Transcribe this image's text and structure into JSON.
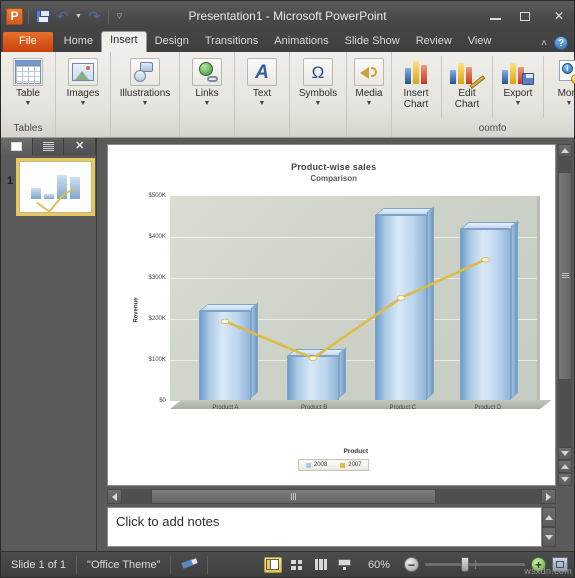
{
  "window": {
    "title": "Presentation1  -  Microsoft PowerPoint",
    "minimize_label": "–",
    "maximize_label": "□",
    "close_label": "✕"
  },
  "quick_access": {
    "app_logo": "P",
    "items": [
      {
        "name": "save-icon",
        "label": "Save"
      },
      {
        "name": "undo-icon",
        "label": "Undo"
      },
      {
        "name": "redo-icon",
        "label": "Redo"
      },
      {
        "name": "customize-icon",
        "label": "Customize Quick Access Toolbar"
      }
    ]
  },
  "tabs": [
    {
      "label": "File",
      "active": false
    },
    {
      "label": "Home",
      "active": false
    },
    {
      "label": "Insert",
      "active": true
    },
    {
      "label": "Design",
      "active": false
    },
    {
      "label": "Transitions",
      "active": false
    },
    {
      "label": "Animations",
      "active": false
    },
    {
      "label": "Slide Show",
      "active": false
    },
    {
      "label": "Review",
      "active": false
    },
    {
      "label": "View",
      "active": false
    }
  ],
  "tab_right": {
    "collapse_ribbon": "˄",
    "help": "?"
  },
  "ribbon": {
    "groups": [
      {
        "label": "Tables",
        "buttons": [
          {
            "label": "Table",
            "icon": "table-icon",
            "has_dropdown": true
          }
        ]
      },
      {
        "label": "",
        "buttons": [
          {
            "label": "Images",
            "icon": "images-icon",
            "has_dropdown": true
          }
        ]
      },
      {
        "label": "",
        "buttons": [
          {
            "label": "Illustrations",
            "icon": "illustrations-icon",
            "has_dropdown": true
          }
        ]
      },
      {
        "label": "",
        "buttons": [
          {
            "label": "Links",
            "icon": "links-icon",
            "has_dropdown": true
          }
        ]
      },
      {
        "label": "",
        "buttons": [
          {
            "label": "Text",
            "icon": "text-icon",
            "has_dropdown": true
          }
        ]
      },
      {
        "label": "",
        "buttons": [
          {
            "label": "Symbols",
            "icon": "symbols-icon",
            "has_dropdown": true
          }
        ]
      },
      {
        "label": "",
        "buttons": [
          {
            "label": "Media",
            "icon": "media-icon",
            "has_dropdown": true
          }
        ]
      }
    ],
    "oomfo": {
      "label": "oomfo",
      "buttons": [
        {
          "label": "Insert\nChart",
          "line1": "Insert",
          "line2": "Chart",
          "icon": "insert-chart-icon",
          "has_dropdown": false
        },
        {
          "label": "Edit\nChart",
          "line1": "Edit",
          "line2": "Chart",
          "icon": "edit-chart-icon",
          "has_dropdown": false
        },
        {
          "label": "Export",
          "line1": "Export",
          "line2": "",
          "icon": "export-icon",
          "has_dropdown": true
        },
        {
          "label": "More",
          "line1": "More",
          "line2": "",
          "icon": "more-icon",
          "has_dropdown": true
        }
      ]
    }
  },
  "slide_pane": {
    "tabs": [
      {
        "name": "slides-tab",
        "label": "Slides"
      },
      {
        "name": "outline-tab",
        "label": "Outline"
      }
    ],
    "close_label": "✕",
    "slides": [
      {
        "number": "1",
        "selected": true
      }
    ]
  },
  "notes": {
    "placeholder": "Click to add notes"
  },
  "status_bar": {
    "slide_count": "Slide 1 of 1",
    "theme": "\"Office Theme\"",
    "spelling_icon": "spelling-icon",
    "views": [
      {
        "name": "normal-view-button",
        "label": "Normal",
        "active": true
      },
      {
        "name": "slide-sorter-button",
        "label": "Slide Sorter",
        "active": false
      },
      {
        "name": "reading-view-button",
        "label": "Reading View",
        "active": false
      },
      {
        "name": "slide-show-button",
        "label": "Slide Show",
        "active": false
      }
    ],
    "zoom_level": "60%",
    "zoom_out_label": "−",
    "zoom_in_label": "+",
    "fit_label": "Fit slide to current window"
  },
  "watermark": "wsxdn.com",
  "chart_data": {
    "type": "bar",
    "title": "Product-wise sales",
    "subtitle": "Comparison",
    "xlabel": "Product",
    "ylabel": "Revenue",
    "categories": [
      "Product A",
      "Product B",
      "Product C",
      "Product D"
    ],
    "ylim": [
      0,
      500000
    ],
    "yticks": [
      0,
      100000,
      200000,
      300000,
      400000,
      500000
    ],
    "ytick_labels": [
      "$0",
      "$100K",
      "$200K",
      "$300K",
      "$400K",
      "$500K"
    ],
    "grid": true,
    "legend_position": "bottom",
    "series": [
      {
        "name": "2008",
        "type": "column3d",
        "color": "#a9cbe8",
        "values": [
          220000,
          110000,
          455000,
          420000
        ]
      },
      {
        "name": "2007",
        "type": "line",
        "color": "#e0bc44",
        "values": [
          195000,
          105000,
          252000,
          345000
        ]
      }
    ]
  }
}
